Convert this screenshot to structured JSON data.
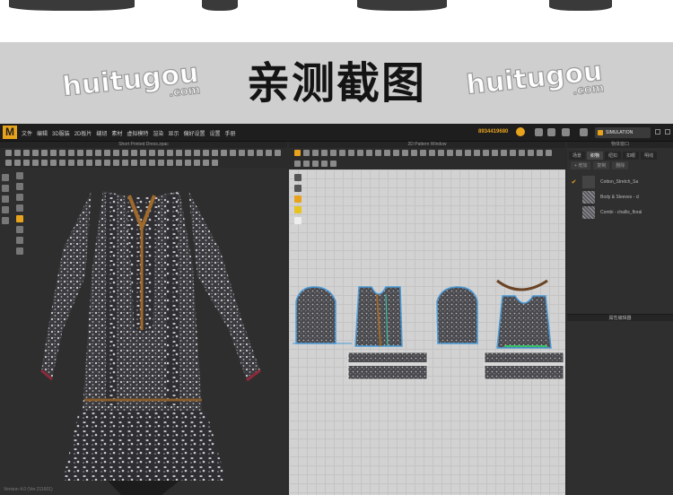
{
  "banner": {
    "title": "亲测截图",
    "watermark_left": "huitugou",
    "watermark_left_sub": ".com",
    "watermark_right": "huitugou",
    "watermark_right_sub": ".com"
  },
  "app": {
    "logo": "M",
    "menu": [
      "文件",
      "编辑",
      "3D服装",
      "2D板片",
      "缝纫",
      "素材",
      "虚拟模特",
      "渲染",
      "显示",
      "偏好设置",
      "设置",
      "手册"
    ],
    "account": "8934419680",
    "simulation_label": "SIMULATION",
    "panel_3d_title": "Short Printed Dress.zpac",
    "panel_2d_title": "2D Pattern Window",
    "right_panel_title": "物体窗口",
    "right_tabs": [
      "场景",
      "织物",
      "纽扣",
      "扣眼",
      "明线"
    ],
    "buttons": [
      "+ 增加",
      "复制",
      "删除"
    ],
    "fabrics": [
      {
        "name": "Cotton_Stretch_Sa",
        "selected": true
      },
      {
        "name": "Body & Sleeves - cl",
        "selected": false
      },
      {
        "name": "Combi - challis_floral",
        "selected": false
      }
    ],
    "property_title": "属性编辑器",
    "status_left": "Version 4.0 (Ver.211601)"
  },
  "colors": {
    "accent": "#e8a31d",
    "trim": "#a06a2c",
    "fabric_dark": "#3b3b3f"
  }
}
